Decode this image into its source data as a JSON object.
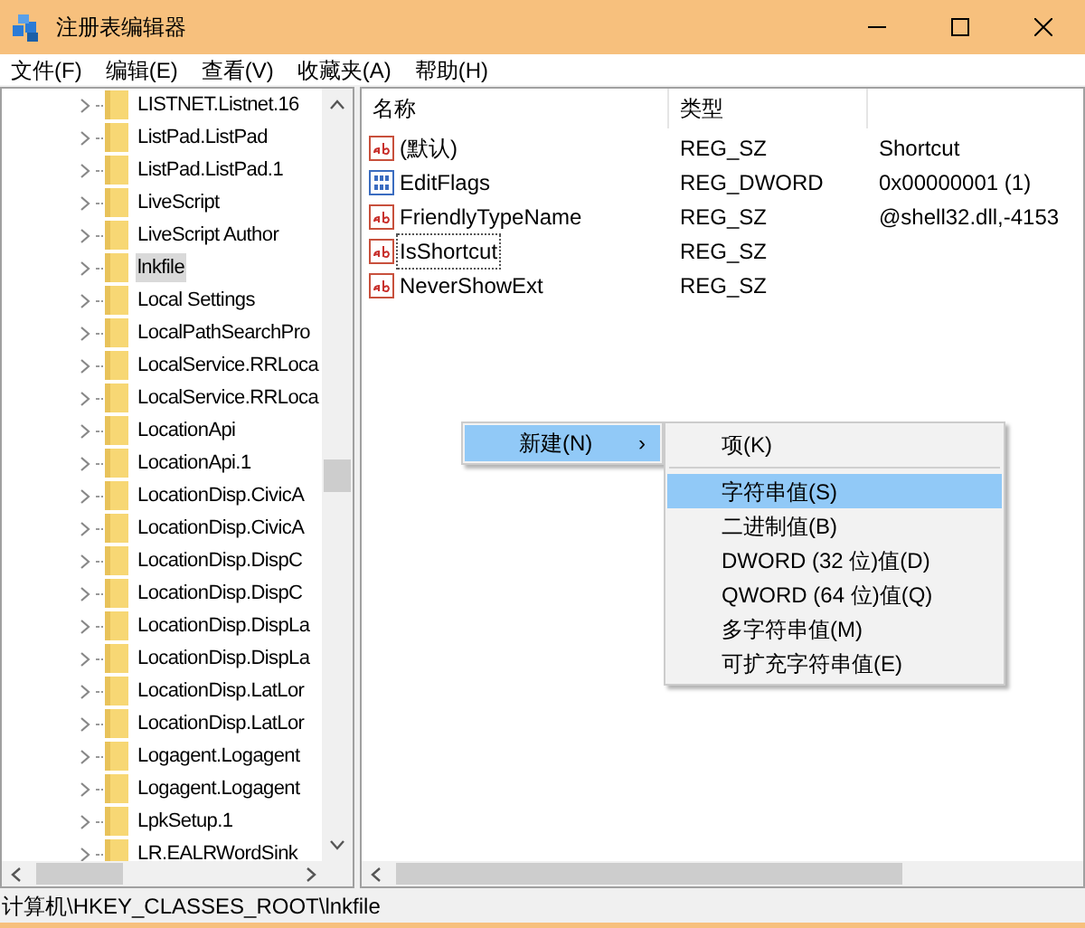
{
  "window": {
    "title": "注册表编辑器"
  },
  "menu": [
    "文件(F)",
    "编辑(E)",
    "查看(V)",
    "收藏夹(A)",
    "帮助(H)"
  ],
  "tree": [
    {
      "label": "LISTNET.Listnet.16",
      "selected": false
    },
    {
      "label": "ListPad.ListPad",
      "selected": false
    },
    {
      "label": "ListPad.ListPad.1",
      "selected": false
    },
    {
      "label": "LiveScript",
      "selected": false
    },
    {
      "label": "LiveScript Author",
      "selected": false
    },
    {
      "label": "lnkfile",
      "selected": true
    },
    {
      "label": "Local Settings",
      "selected": false
    },
    {
      "label": "LocalPathSearchPro",
      "selected": false
    },
    {
      "label": "LocalService.RRLoca",
      "selected": false
    },
    {
      "label": "LocalService.RRLoca",
      "selected": false
    },
    {
      "label": "LocationApi",
      "selected": false
    },
    {
      "label": "LocationApi.1",
      "selected": false
    },
    {
      "label": "LocationDisp.CivicA",
      "selected": false
    },
    {
      "label": "LocationDisp.CivicA",
      "selected": false
    },
    {
      "label": "LocationDisp.DispC",
      "selected": false
    },
    {
      "label": "LocationDisp.DispC",
      "selected": false
    },
    {
      "label": "LocationDisp.DispLa",
      "selected": false
    },
    {
      "label": "LocationDisp.DispLa",
      "selected": false
    },
    {
      "label": "LocationDisp.LatLor",
      "selected": false
    },
    {
      "label": "LocationDisp.LatLor",
      "selected": false
    },
    {
      "label": "Logagent.Logagent",
      "selected": false
    },
    {
      "label": "Logagent.Logagent",
      "selected": false
    },
    {
      "label": "LpkSetup.1",
      "selected": false
    },
    {
      "label": "LR.EALRWordSink",
      "selected": false
    }
  ],
  "table": {
    "columns": [
      "名称",
      "类型"
    ],
    "rows": [
      {
        "kind": "string",
        "name": "(默认)",
        "type": "REG_SZ",
        "data": "Shortcut",
        "focused": false
      },
      {
        "kind": "binary",
        "name": "EditFlags",
        "type": "REG_DWORD",
        "data": "0x00000001 (1)",
        "focused": false
      },
      {
        "kind": "string",
        "name": "FriendlyTypeName",
        "type": "REG_SZ",
        "data": "@shell32.dll,-4153",
        "focused": false
      },
      {
        "kind": "string",
        "name": "IsShortcut",
        "type": "REG_SZ",
        "focused": true
      },
      {
        "kind": "string",
        "name": "NeverShowExt",
        "type": "REG_SZ",
        "focused": false
      }
    ]
  },
  "context_menu": {
    "label": "新建(N)",
    "selected": true,
    "arrow": "›",
    "submenu": [
      {
        "label": "项(K)",
        "selected": false,
        "separator_after": true
      },
      {
        "label": "字符串值(S)",
        "selected": true
      },
      {
        "label": "二进制值(B)",
        "selected": false
      },
      {
        "label": "DWORD (32 位)值(D)",
        "selected": false
      },
      {
        "label": "QWORD (64 位)值(Q)",
        "selected": false
      },
      {
        "label": "多字符串值(M)",
        "selected": false
      },
      {
        "label": "可扩充字符串值(E)",
        "selected": false
      }
    ]
  },
  "status_bar": "计算机\\HKEY_CLASSES_ROOT\\lnkfile"
}
